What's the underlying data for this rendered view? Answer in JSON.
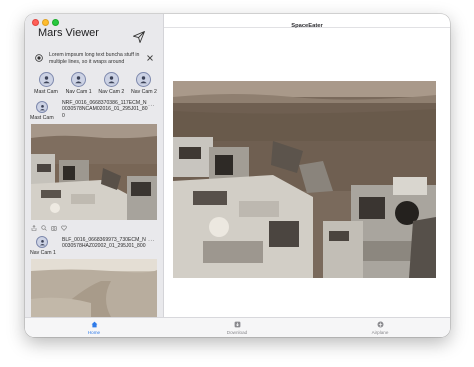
{
  "window": {
    "title": "SpaceEater"
  },
  "sidebar": {
    "app_title": "Mars Viewer",
    "banner": {
      "text": "Lorem impsum long text buncha stuff in multiple lines, so it wraps around"
    },
    "cameras": [
      {
        "label": "Mast Cam"
      },
      {
        "label": "Nav Cam 1"
      },
      {
        "label": "Nav Cam 2"
      },
      {
        "label": "Nav Cam 2"
      }
    ],
    "posts": [
      {
        "camera": "Mast Cam",
        "image_id": "NRF_0016_0668370386_117ECM_N0030578NCAM02016_01_295J01_800",
        "more": "···"
      },
      {
        "camera": "Nav Cam 1",
        "image_id": "BLF_0016_0668369973_730ECM_N0030578HAZ02002_01_295J01_800",
        "more": "···"
      }
    ]
  },
  "tabs": [
    {
      "label": "Home",
      "icon": "home-icon",
      "active": true
    },
    {
      "label": "Download",
      "icon": "download-icon",
      "active": false
    },
    {
      "label": "Airplane",
      "icon": "airplane-icon",
      "active": false
    }
  ],
  "colors": {
    "accent": "#2f7be9",
    "avatar_ring": "#7e89ad",
    "sidebar_bg": "#e9e9ec"
  }
}
